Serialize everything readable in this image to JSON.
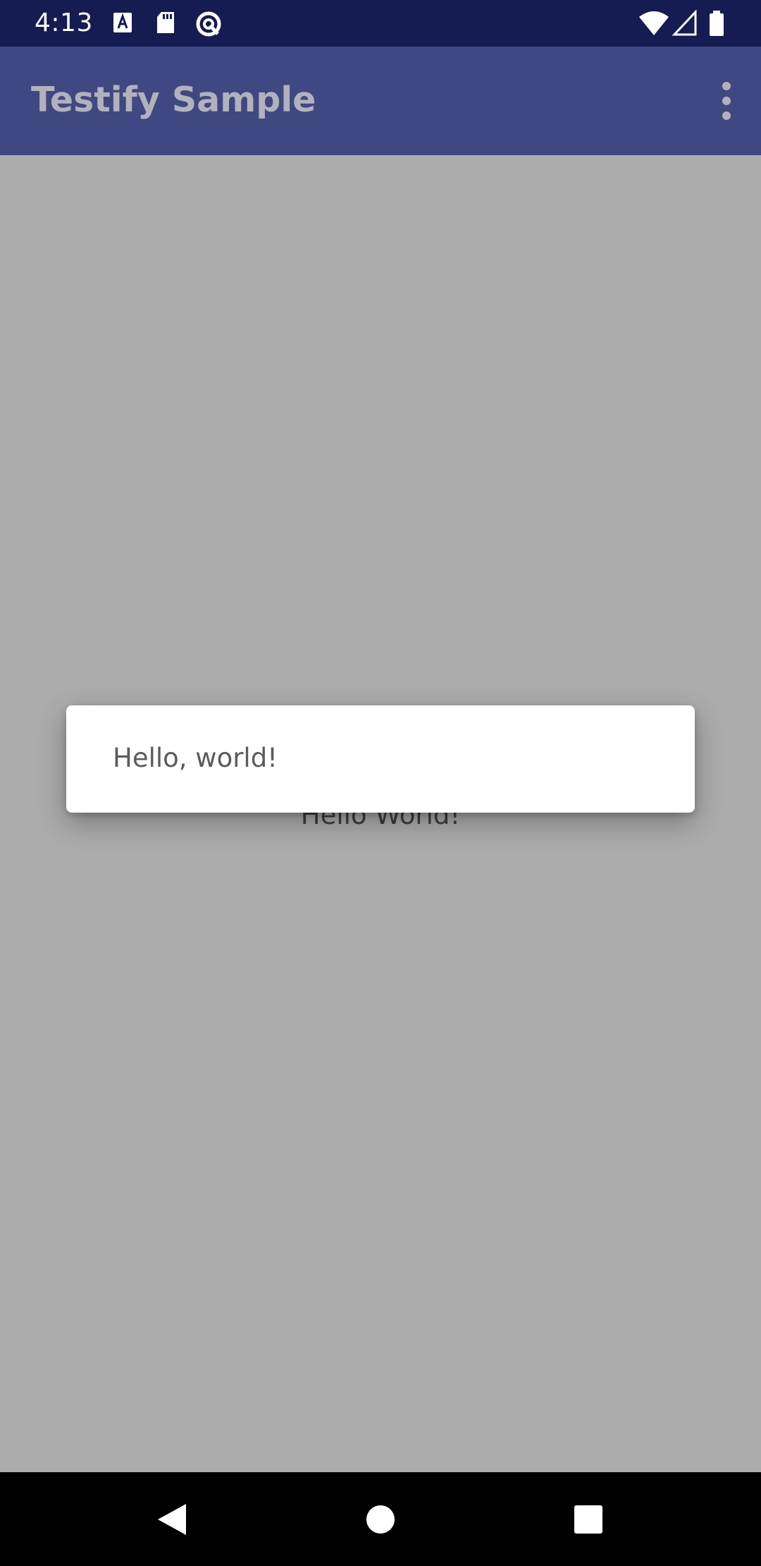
{
  "status_bar": {
    "time": "4:13",
    "left_icons": [
      "font-download-icon",
      "sd-card-icon",
      "data-saver-icon"
    ],
    "right_icons": [
      "wifi-icon",
      "cell-signal-icon",
      "battery-icon"
    ]
  },
  "app_bar": {
    "title": "Testify Sample",
    "overflow_icon": "more-vert-icon"
  },
  "content": {
    "text": "Hello World!"
  },
  "dialog": {
    "message": "Hello, world!"
  },
  "nav_bar": {
    "buttons": [
      "back-icon",
      "home-icon",
      "recents-icon"
    ]
  },
  "colors": {
    "status_bar": "#141c52",
    "app_bar": "#404883",
    "scrim_background": "#acacac",
    "dialog": "#ffffff",
    "nav_bar": "#000000"
  }
}
